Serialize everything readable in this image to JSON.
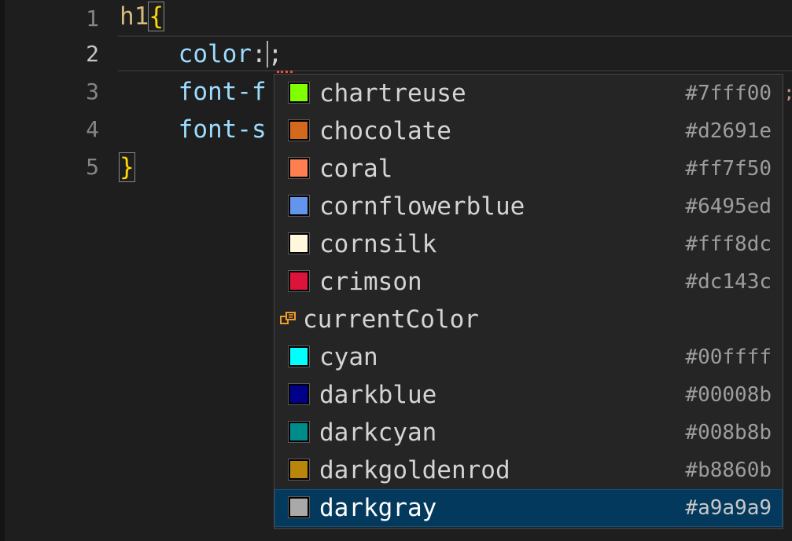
{
  "editor": {
    "line_numbers": [
      "1",
      "2",
      "3",
      "4",
      "5"
    ],
    "code": {
      "line1": {
        "selector": "h1",
        "open_brace": "{"
      },
      "line2": {
        "indent": "    ",
        "property": "color",
        "colon": ":",
        "semicolon": ";"
      },
      "line3": {
        "indent": "    ",
        "text": "font-f"
      },
      "line4": {
        "indent": "    ",
        "text": "font-s"
      },
      "line5": {
        "close_brace": "}"
      }
    },
    "peek_char": ";"
  },
  "suggestions": [
    {
      "label": "chartreuse",
      "detail": "#7fff00",
      "swatch": "#7fff00"
    },
    {
      "label": "chocolate",
      "detail": "#d2691e",
      "swatch": "#d2691e"
    },
    {
      "label": "coral",
      "detail": "#ff7f50",
      "swatch": "#ff7f50"
    },
    {
      "label": "cornflowerblue",
      "detail": "#6495ed",
      "swatch": "#6495ed"
    },
    {
      "label": "cornsilk",
      "detail": "#fff8dc",
      "swatch": "#fff8dc"
    },
    {
      "label": "crimson",
      "detail": "#dc143c",
      "swatch": "#dc143c"
    },
    {
      "label": "currentColor",
      "detail": "",
      "icon": "keyword-icon"
    },
    {
      "label": "cyan",
      "detail": "#00ffff",
      "swatch": "#00ffff"
    },
    {
      "label": "darkblue",
      "detail": "#00008b",
      "swatch": "#00008b"
    },
    {
      "label": "darkcyan",
      "detail": "#008b8b",
      "swatch": "#008b8b"
    },
    {
      "label": "darkgoldenrod",
      "detail": "#b8860b",
      "swatch": "#b8860b"
    },
    {
      "label": "darkgray",
      "detail": "#a9a9a9",
      "swatch": "#a9a9a9",
      "selected": true
    }
  ],
  "colors": {
    "background": "#1e1e1e",
    "widget_background": "#252526",
    "selected_row": "#04395e",
    "property": "#9cdcfe",
    "selector": "#d7ba7d",
    "brace": "#ffd700"
  }
}
